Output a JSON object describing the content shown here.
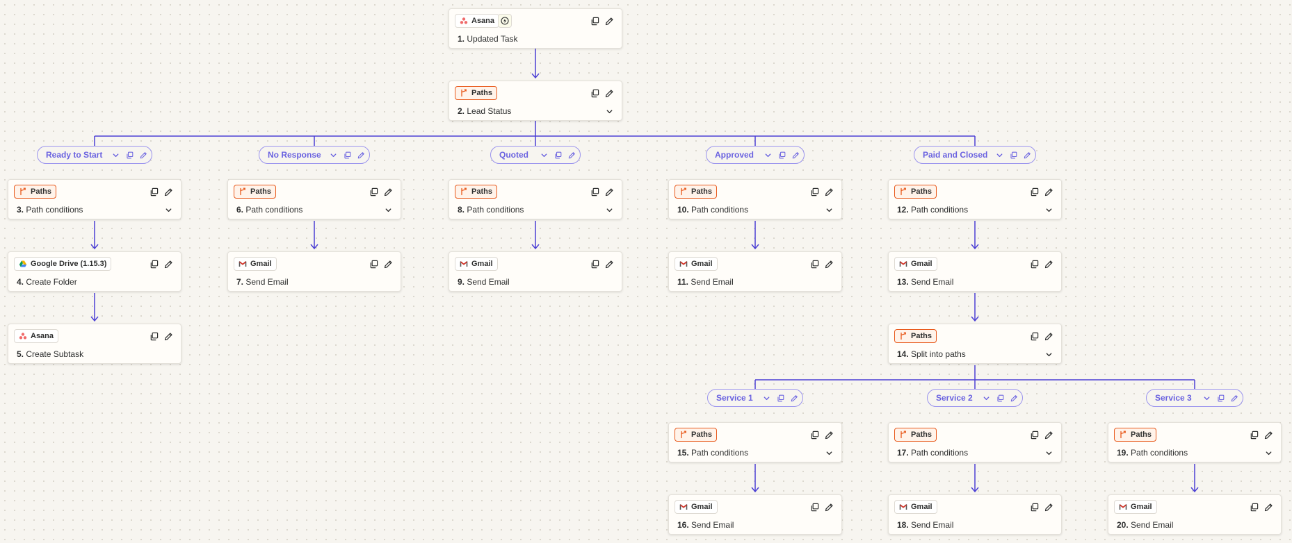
{
  "colors": {
    "connector": "#4b3fd4",
    "path_label": "#6a62e0",
    "paths_accent": "#e8581a"
  },
  "steps": [
    {
      "num": "1.",
      "title": "Updated Task",
      "app": "Asana",
      "icon": "asana-icon",
      "trigger": true
    },
    {
      "num": "2.",
      "title": "Lead Status",
      "app": "Paths",
      "icon": "paths-icon",
      "expandable": true
    },
    {
      "num": "3.",
      "title": "Path conditions",
      "app": "Paths",
      "icon": "paths-icon",
      "expandable": true
    },
    {
      "num": "4.",
      "title": "Create Folder",
      "app": "Google Drive (1.15.3)",
      "icon": "google-drive-icon"
    },
    {
      "num": "5.",
      "title": "Create Subtask",
      "app": "Asana",
      "icon": "asana-icon"
    },
    {
      "num": "6.",
      "title": "Path conditions",
      "app": "Paths",
      "icon": "paths-icon",
      "expandable": true
    },
    {
      "num": "7.",
      "title": "Send Email",
      "app": "Gmail",
      "icon": "gmail-icon"
    },
    {
      "num": "8.",
      "title": "Path conditions",
      "app": "Paths",
      "icon": "paths-icon",
      "expandable": true
    },
    {
      "num": "9.",
      "title": "Send Email",
      "app": "Gmail",
      "icon": "gmail-icon"
    },
    {
      "num": "10.",
      "title": "Path conditions",
      "app": "Paths",
      "icon": "paths-icon",
      "expandable": true
    },
    {
      "num": "11.",
      "title": "Send Email",
      "app": "Gmail",
      "icon": "gmail-icon"
    },
    {
      "num": "12.",
      "title": "Path conditions",
      "app": "Paths",
      "icon": "paths-icon",
      "expandable": true
    },
    {
      "num": "13.",
      "title": "Send Email",
      "app": "Gmail",
      "icon": "gmail-icon"
    },
    {
      "num": "14.",
      "title": "Split into paths",
      "app": "Paths",
      "icon": "paths-icon",
      "expandable": true
    },
    {
      "num": "15.",
      "title": "Path conditions",
      "app": "Paths",
      "icon": "paths-icon",
      "expandable": true
    },
    {
      "num": "16.",
      "title": "Send Email",
      "app": "Gmail",
      "icon": "gmail-icon"
    },
    {
      "num": "17.",
      "title": "Path conditions",
      "app": "Paths",
      "icon": "paths-icon",
      "expandable": true
    },
    {
      "num": "18.",
      "title": "Send Email",
      "app": "Gmail",
      "icon": "gmail-icon"
    },
    {
      "num": "19.",
      "title": "Path conditions",
      "app": "Paths",
      "icon": "paths-icon",
      "expandable": true
    },
    {
      "num": "20.",
      "title": "Send Email",
      "app": "Gmail",
      "icon": "gmail-icon"
    }
  ],
  "paths": [
    {
      "label": "Ready to Start"
    },
    {
      "label": "No Response"
    },
    {
      "label": "Quoted"
    },
    {
      "label": "Approved"
    },
    {
      "label": "Paid and Closed"
    },
    {
      "label": "Service 1"
    },
    {
      "label": "Service 2"
    },
    {
      "label": "Service 3"
    }
  ]
}
